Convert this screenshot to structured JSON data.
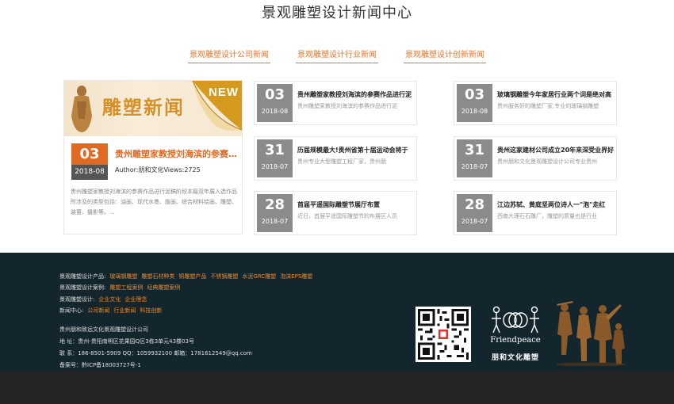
{
  "section": {
    "title": "景观雕塑设计新闻中心",
    "tabs": [
      "景观雕塑设计公司新闻",
      "景观雕塑设计行业新闻",
      "景观雕塑设计创新新闻"
    ]
  },
  "feature": {
    "banner_text": "雕塑新闻",
    "banner_badge": "NEW",
    "day": "03",
    "ym": "2018-08",
    "title": "贵州雕塑家教授刘海滨的参赛作...",
    "meta": "Author:朋和文化Views:2725",
    "desc": "贵州雕塑家教授刘海滨的参赛作品进行泥稿阶段本篇双年展入选作品所涉及的类型包括：油画、现代水墨、版画、综合材料绘画、雕塑、装置、摄影等。..."
  },
  "news": [
    {
      "day": "03",
      "ym": "2018-08",
      "title": "贵州雕塑家教授刘海滨的参赛作品进行泥",
      "summary": "贵州雕塑家教授刘海滨的参赛作品进行泥"
    },
    {
      "day": "03",
      "ym": "2018-08",
      "title": "玻璃钢雕塑今年家居行业两个词是绝对高",
      "summary": "贵州服务好的雕塑厂家,专业的玻璃钢雕塑"
    },
    {
      "day": "31",
      "ym": "2018-07",
      "title": "历届规模最大!贵州省第十届运动会将于",
      "summary": "贵州专业大型雕塑工程厂家，贵州朋"
    },
    {
      "day": "31",
      "ym": "2018-07",
      "title": "贵州这家建材公司成立20年来深受业界好",
      "summary": "贵州朋和文化景观雕塑设计公司专业贵州"
    },
    {
      "day": "28",
      "ym": "2018-07",
      "title": "首届平遥国际雕塑节展厅布置",
      "summary": "近日，首届平遥国际雕塑节的布展区人员"
    },
    {
      "day": "28",
      "ym": "2018-07",
      "title": "江边苏轼、黄庭坚两位诗人一\"泡\"走红",
      "summary": "西南大理石石雕厂，雕塑的质量也是行业"
    }
  ],
  "footer": {
    "rows": [
      {
        "label": "景观雕塑设计产品:",
        "links": [
          "玻璃钢雕塑",
          "雕塑石材种类",
          "铜雕塑产品",
          "不锈钢雕塑",
          "水泥GRC雕塑",
          "泡沫EPS雕塑"
        ]
      },
      {
        "label": "景观雕塑设计案例:",
        "links": [
          "雕塑工程案例",
          "经典雕塑案例"
        ]
      },
      {
        "label": "景观雕塑设计:",
        "links": [
          "企业文化",
          "企业理念"
        ]
      },
      {
        "label": "新闻中心:",
        "links": [
          "公司新闻",
          "行业新闻",
          "科技创新"
        ]
      }
    ],
    "company": "贵州朋和致远文化景观雕塑设计公司",
    "address": "地  址：贵州-贵阳南明区花果园Q区3栋3单元43楼03号",
    "contact": "联  系：186-8501-5909 QQ：1059932100 邮箱：1781612549@qq.com",
    "icp": "备案号：黔ICP备18003727号-1",
    "logo_en": "Friendpeace",
    "logo_cn": "朋和文化雕塑"
  },
  "colors": {
    "accent": "#e06a23",
    "footer_bg": "#13252d",
    "link": "#e98a2c",
    "date_gray": "#8b8b8b"
  }
}
